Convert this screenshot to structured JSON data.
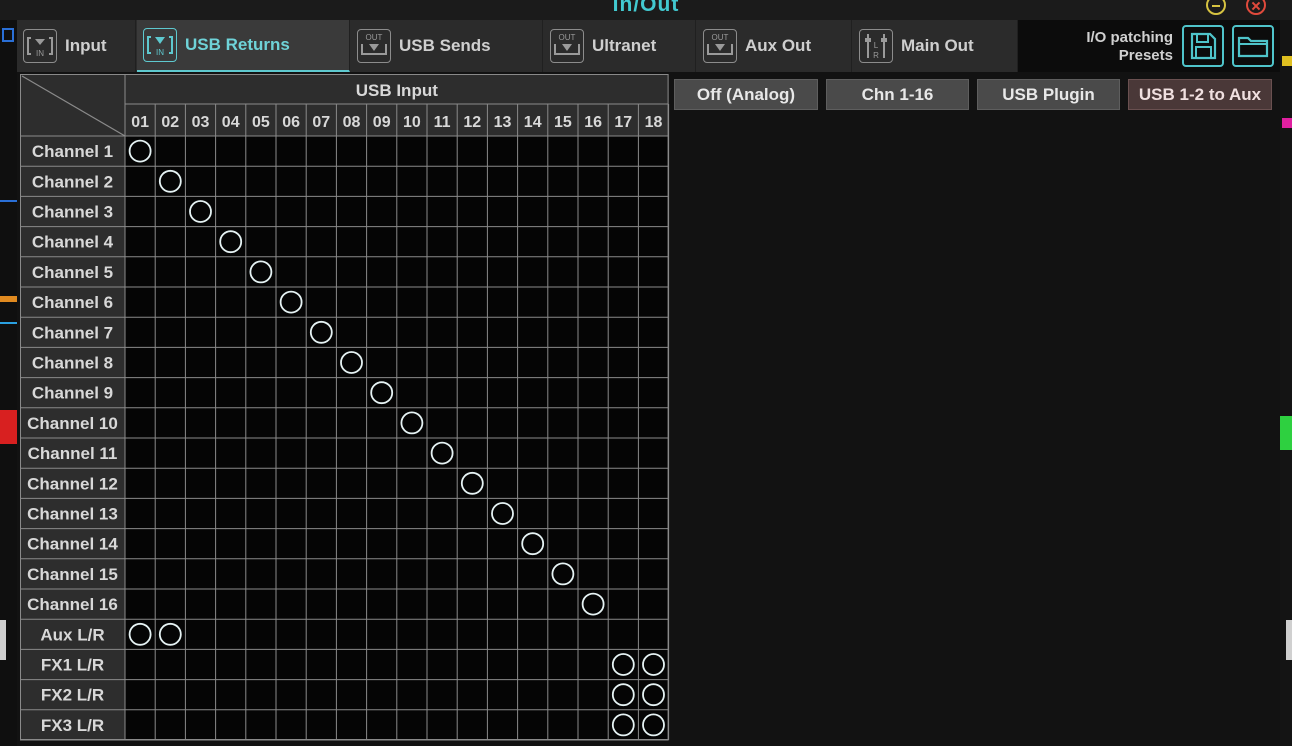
{
  "window": {
    "title": "In/Out"
  },
  "tabs": [
    {
      "label": "Input",
      "icon": "in-port-icon",
      "active": false
    },
    {
      "label": "USB Returns",
      "icon": "usb-in-icon",
      "active": true
    },
    {
      "label": "USB Sends",
      "icon": "out-port-icon",
      "active": false
    },
    {
      "label": "Ultranet",
      "icon": "out-port-icon",
      "active": false
    },
    {
      "label": "Aux Out",
      "icon": "out-port-icon",
      "active": false
    },
    {
      "label": "Main Out",
      "icon": "lr-fader-icon",
      "active": false
    }
  ],
  "presets": {
    "label_line1": "I/O patching",
    "label_line2": "Presets"
  },
  "grid": {
    "header": "USB Input",
    "columns": [
      "01",
      "02",
      "03",
      "04",
      "05",
      "06",
      "07",
      "08",
      "09",
      "10",
      "11",
      "12",
      "13",
      "14",
      "15",
      "16",
      "17",
      "18"
    ],
    "rows": [
      "Channel 1",
      "Channel 2",
      "Channel 3",
      "Channel 4",
      "Channel 5",
      "Channel 6",
      "Channel 7",
      "Channel 8",
      "Channel 9",
      "Channel 10",
      "Channel 11",
      "Channel 12",
      "Channel 13",
      "Channel 14",
      "Channel 15",
      "Channel 16",
      "Aux L/R",
      "FX1 L/R",
      "FX2 L/R",
      "FX3 L/R"
    ],
    "connections": [
      [
        0,
        0
      ],
      [
        1,
        1
      ],
      [
        2,
        2
      ],
      [
        3,
        3
      ],
      [
        4,
        4
      ],
      [
        5,
        5
      ],
      [
        6,
        6
      ],
      [
        7,
        7
      ],
      [
        8,
        8
      ],
      [
        9,
        9
      ],
      [
        10,
        10
      ],
      [
        11,
        11
      ],
      [
        12,
        12
      ],
      [
        13,
        13
      ],
      [
        14,
        14
      ],
      [
        15,
        15
      ],
      [
        16,
        0
      ],
      [
        16,
        1
      ],
      [
        17,
        16
      ],
      [
        17,
        17
      ],
      [
        18,
        16
      ],
      [
        18,
        17
      ],
      [
        19,
        16
      ],
      [
        19,
        17
      ]
    ]
  },
  "buttons": [
    {
      "label": "Off (Analog)",
      "selected": false
    },
    {
      "label": "Chn 1-16",
      "selected": false
    },
    {
      "label": "USB Plugin",
      "selected": false
    },
    {
      "label": "USB 1-2 to Aux",
      "selected": true
    }
  ],
  "colors": {
    "accent": "#5ec9cf",
    "grid_line": "#8a8a8a",
    "cell_bg": "#050505",
    "header_bg": "#2d2d2d"
  }
}
